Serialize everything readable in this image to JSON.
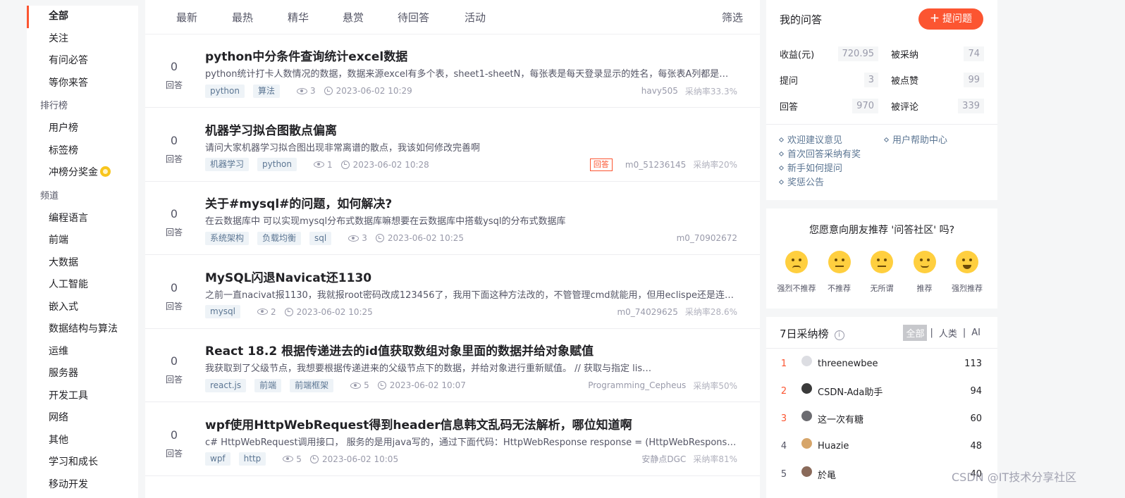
{
  "leftnav": {
    "items": [
      {
        "label": "全部",
        "type": "item",
        "active": true
      },
      {
        "label": "关注",
        "type": "item"
      },
      {
        "label": "有问必答",
        "type": "item"
      },
      {
        "label": "等你来答",
        "type": "item"
      },
      {
        "label": "排行榜",
        "type": "group"
      },
      {
        "label": "用户榜",
        "type": "item"
      },
      {
        "label": "标签榜",
        "type": "item"
      },
      {
        "label": "冲榜分奖金",
        "type": "item",
        "icon": "coin-icon"
      },
      {
        "label": "频道",
        "type": "group"
      },
      {
        "label": "编程语言",
        "type": "item"
      },
      {
        "label": "前端",
        "type": "item"
      },
      {
        "label": "大数据",
        "type": "item"
      },
      {
        "label": "人工智能",
        "type": "item"
      },
      {
        "label": "嵌入式",
        "type": "item"
      },
      {
        "label": "数据结构与算法",
        "type": "item"
      },
      {
        "label": "运维",
        "type": "item"
      },
      {
        "label": "服务器",
        "type": "item"
      },
      {
        "label": "开发工具",
        "type": "item"
      },
      {
        "label": "网络",
        "type": "item"
      },
      {
        "label": "其他",
        "type": "item"
      },
      {
        "label": "学习和成长",
        "type": "item"
      },
      {
        "label": "移动开发",
        "type": "item"
      }
    ]
  },
  "tabs": [
    "最新",
    "最热",
    "精华",
    "悬赏",
    "待回答",
    "活动"
  ],
  "filter_label": "筛选",
  "answers_label": "回答",
  "questions": [
    {
      "count": "0",
      "title": "python中分条件查询统计excel数据",
      "desc": "python统计打卡人数情况的数据，数据来源excel有多个表，sheet1-sheetN，每张表是每天登录显示的姓名，每张表A列都是…",
      "tags": [
        "python",
        "算法"
      ],
      "views": "3",
      "time": "2023-06-02 10:29",
      "user": "havy505",
      "rate": "采纳率33.3%",
      "badge": ""
    },
    {
      "count": "0",
      "title": "机器学习拟合图散点偏离",
      "desc": "请问大家机器学习拟合图出现非常离谱的散点，我该如何修改完善啊",
      "tags": [
        "机器学习",
        "python"
      ],
      "views": "1",
      "time": "2023-06-02 10:28",
      "user": "m0_51236145",
      "rate": "采纳率20%",
      "badge": "回答"
    },
    {
      "count": "0",
      "title": "关于#mysql#的问题，如何解决?",
      "desc": "在云数据库中 可以实现mysql分布式数据库嘛想要在云数据库中搭载ysql的分布式数据库",
      "tags": [
        "系统架构",
        "负载均衡",
        "sql"
      ],
      "views": "3",
      "time": "2023-06-02 10:25",
      "user": "m0_70902672",
      "rate": "",
      "badge": ""
    },
    {
      "count": "0",
      "title": "MySQL闪退Navicat还1130",
      "desc": "之前一直nacivat报1130，我就报root密码改成123456了，我用下面这种方法改的，不管管理cmd就能用，但用eclispe还是连…",
      "tags": [
        "mysql"
      ],
      "views": "2",
      "time": "2023-06-02 10:25",
      "user": "m0_74029625",
      "rate": "采纳率28.6%",
      "badge": ""
    },
    {
      "count": "0",
      "title": "React 18.2 根据传递进去的id值获取数组对象里面的数据并给对象赋值",
      "desc": "我获取到了父级节点，我想要根据传递进来的父级节点下的数据，并给对象进行重新赋值。 // 获取与指定 lis…",
      "tags": [
        "react.js",
        "前端",
        "前端框架"
      ],
      "views": "5",
      "time": "2023-06-02 10:07",
      "user": "Programming_Cepheus",
      "rate": "采纳率50%",
      "badge": ""
    },
    {
      "count": "0",
      "title": "wpf使用HttpWebRequest得到header信息韩文乱码无法解析，哪位知道啊",
      "desc": "c# HttpWebRequest调用接口， 服务的是用java写的，通过下面代码：HttpWebResponse response = (HttpWebResponse)re…",
      "tags": [
        "wpf",
        "http"
      ],
      "views": "5",
      "time": "2023-06-02 10:05",
      "user": "安静点DGC",
      "rate": "采纳率81%",
      "badge": ""
    }
  ],
  "myqa": {
    "title": "我的问答",
    "ask_label": "提问题",
    "stats": [
      [
        {
          "label": "收益(元)",
          "value": "720.95"
        },
        {
          "label": "被采纳",
          "value": "74"
        }
      ],
      [
        {
          "label": "提问",
          "value": "3"
        },
        {
          "label": "被点赞",
          "value": "99"
        }
      ],
      [
        {
          "label": "回答",
          "value": "970"
        },
        {
          "label": "被评论",
          "value": "339"
        }
      ]
    ],
    "links": [
      [
        "欢迎建议意见",
        "用户帮助中心"
      ],
      [
        "首次回答采纳有奖"
      ],
      [
        "新手如何提问"
      ],
      [
        "奖惩公告"
      ]
    ]
  },
  "survey": {
    "question": "您愿意向朋友推荐 '问答社区' 吗?",
    "options": [
      "强烈不推荐",
      "不推荐",
      "无所谓",
      "推荐",
      "强烈推荐"
    ]
  },
  "rank": {
    "title": "7日采纳榜",
    "filters": [
      "全部",
      "人类",
      "AI"
    ],
    "rows": [
      {
        "rank": "1",
        "name": "threenewbee",
        "value": "113",
        "avatar_color": "#dcdde2"
      },
      {
        "rank": "2",
        "name": "CSDN-Ada助手",
        "value": "94",
        "avatar_color": "#3a3a3a"
      },
      {
        "rank": "3",
        "name": "这一次有糖",
        "value": "60",
        "avatar_color": "#6b6b70"
      },
      {
        "rank": "4",
        "name": "Huazie",
        "value": "48",
        "avatar_color": "#d6a56a"
      },
      {
        "rank": "5",
        "name": "於黾",
        "value": "40",
        "avatar_color": "#8a6a5a"
      }
    ]
  },
  "watermark": "CSDN @IT技术分享社区",
  "colors": {
    "accent": "#fc5531",
    "tag_bg": "#eef3f7",
    "tag_text": "#5c7693",
    "link": "#5c7693"
  }
}
